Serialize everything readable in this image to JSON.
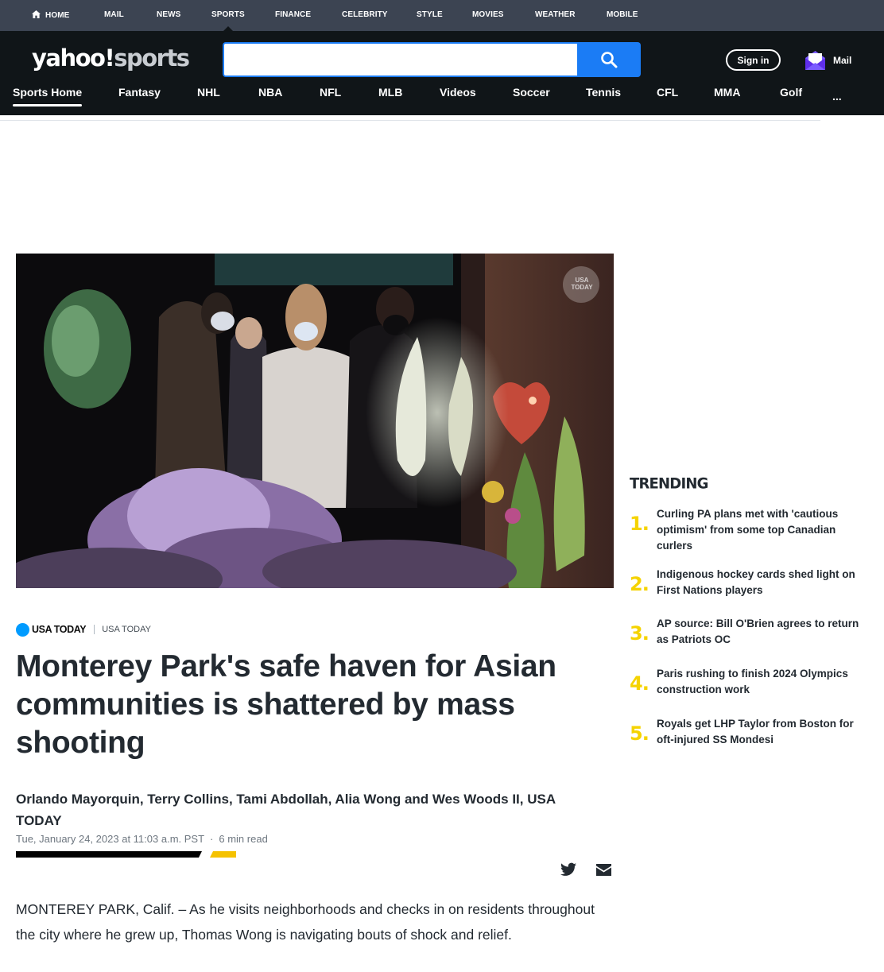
{
  "topnav": {
    "items": [
      "HOME",
      "MAIL",
      "NEWS",
      "SPORTS",
      "FINANCE",
      "CELEBRITY",
      "STYLE",
      "MOVIES",
      "WEATHER",
      "MOBILE"
    ],
    "active": "SPORTS"
  },
  "header": {
    "logo_main": "yahoo!",
    "logo_sub": "sports",
    "search_placeholder": "",
    "signin_label": "Sign in",
    "mail_label": "Mail"
  },
  "sportsnav": {
    "items": [
      "Sports Home",
      "Fantasy",
      "NHL",
      "NBA",
      "NFL",
      "MLB",
      "Videos",
      "Soccer",
      "Tennis",
      "CFL",
      "MMA",
      "Golf"
    ],
    "more": "...",
    "active": "Sports Home"
  },
  "hero": {
    "watermark": "USA TODAY"
  },
  "article": {
    "source_logo": "USA TODAY",
    "source_name": "USA TODAY",
    "headline": "Monterey Park's safe haven for Asian communities is shattered by mass shooting",
    "authors": "Orlando Mayorquin, Terry Collins, Tami Abdollah, Alia Wong and Wes Woods II, USA TODAY",
    "date": "Tue, January 24, 2023 at 11:03 a.m. PST",
    "read_time": "6 min read",
    "body_first": "MONTEREY PARK, Calif. – As he visits neighborhoods and checks in on residents throughout the city where he grew up, Thomas Wong is navigating bouts of shock and relief."
  },
  "trending": {
    "title": "TRENDING",
    "items": [
      {
        "num": "1.",
        "text": "Curling PA plans met with 'cautious optimism' from some top Canadian curlers"
      },
      {
        "num": "2.",
        "text": "Indigenous hockey cards shed light on First Nations players"
      },
      {
        "num": "3.",
        "text": "AP source: Bill O'Brien agrees to return as Patriots OC"
      },
      {
        "num": "4.",
        "text": "Paris rushing to finish 2024 Olympics construction work"
      },
      {
        "num": "5.",
        "text": "Royals get LHP Taylor from Boston for oft-injured SS Mondesi"
      }
    ]
  },
  "colors": {
    "topbar": "#3c4452",
    "header": "#101518",
    "search_blue": "#1b7cf5",
    "trending_yellow": "#f5d300",
    "usa_blue": "#009bff"
  }
}
